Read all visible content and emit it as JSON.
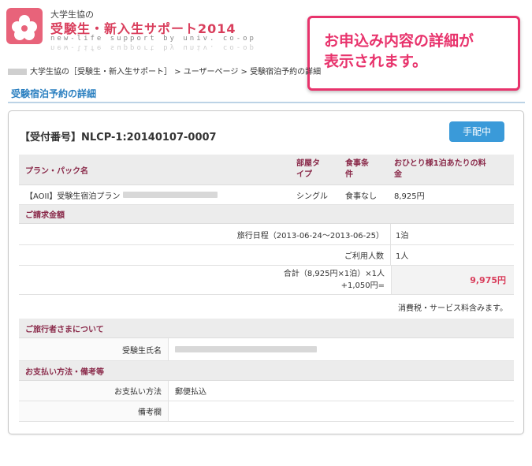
{
  "header": {
    "brand_small": "大学生協の",
    "brand_main": "受験生・新入生サポート2014",
    "brand_sub": "new-life support by univ. co-op"
  },
  "callout": {
    "line1": "お申込み内容の詳細が",
    "line2": "表示されます。"
  },
  "breadcrumb": {
    "text": "大学生協の［受験生・新入生サポート］ > ユーザーページ > 受験宿泊予約の詳細"
  },
  "page_title": "受験宿泊予約の詳細",
  "receipt": {
    "label": "【受付番号】NLCP-1:20140107-0007",
    "status": "手配中"
  },
  "plan_table": {
    "headers": {
      "plan": "プラン・パック名",
      "room_l1": "部屋タ",
      "room_l2": "イプ",
      "meal_l1": "食事条",
      "meal_l2": "件",
      "price_l1": "おひとり様1泊あたりの料",
      "price_l2": "金"
    },
    "row": {
      "plan": "【AOII】受験生宿泊プラン",
      "room": "シングル",
      "meal": "食事なし",
      "price": "8,925円"
    }
  },
  "billing": {
    "section": "ご請求金額",
    "travel_label": "旅行日程（2013-06-24〜2013-06-25）",
    "travel_value": "1泊",
    "persons_label": "ご利用人数",
    "persons_value": "1人",
    "total_label_l1": "合計（8,925円×1泊）×1人",
    "total_label_l2": "+1,050円=",
    "total_value": "9,975円",
    "tax_note": "消費税・サービス料含みます。"
  },
  "traveler": {
    "section": "ご旅行者さまについて",
    "name_label": "受験生氏名"
  },
  "payment": {
    "section": "お支払い方法・備考等",
    "method_label": "お支払い方法",
    "method_value": "郵便払込",
    "notes_label": "備考欄",
    "notes_value": ""
  },
  "colors": {
    "accent_pink": "#e8336c",
    "brand_red": "#d93e5c",
    "link_blue": "#2a7fc0",
    "button_blue": "#3a9ad9",
    "section_maroon": "#8a2a4a"
  }
}
